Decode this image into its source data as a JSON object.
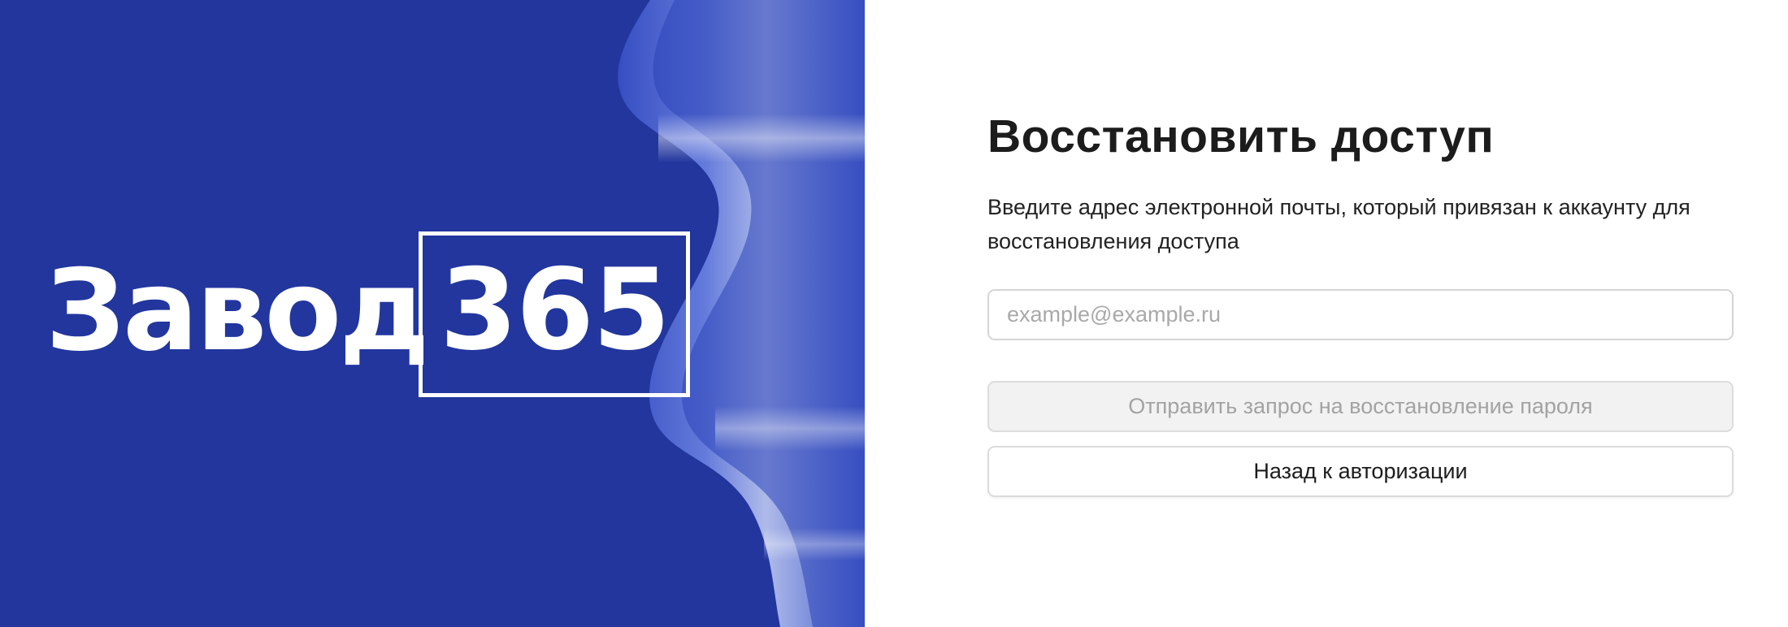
{
  "brand": {
    "logo_word": "Завод",
    "logo_number": "365",
    "background_color": "#22369e"
  },
  "form": {
    "title": "Восстановить доступ",
    "description": "Введите адрес электронной почты, который привязан к аккаунту для восстановления доступа",
    "email_placeholder": "example@example.ru",
    "email_value": "",
    "submit_label": "Отправить запрос на восстановление пароля",
    "back_label": "Назад к авторизации"
  }
}
